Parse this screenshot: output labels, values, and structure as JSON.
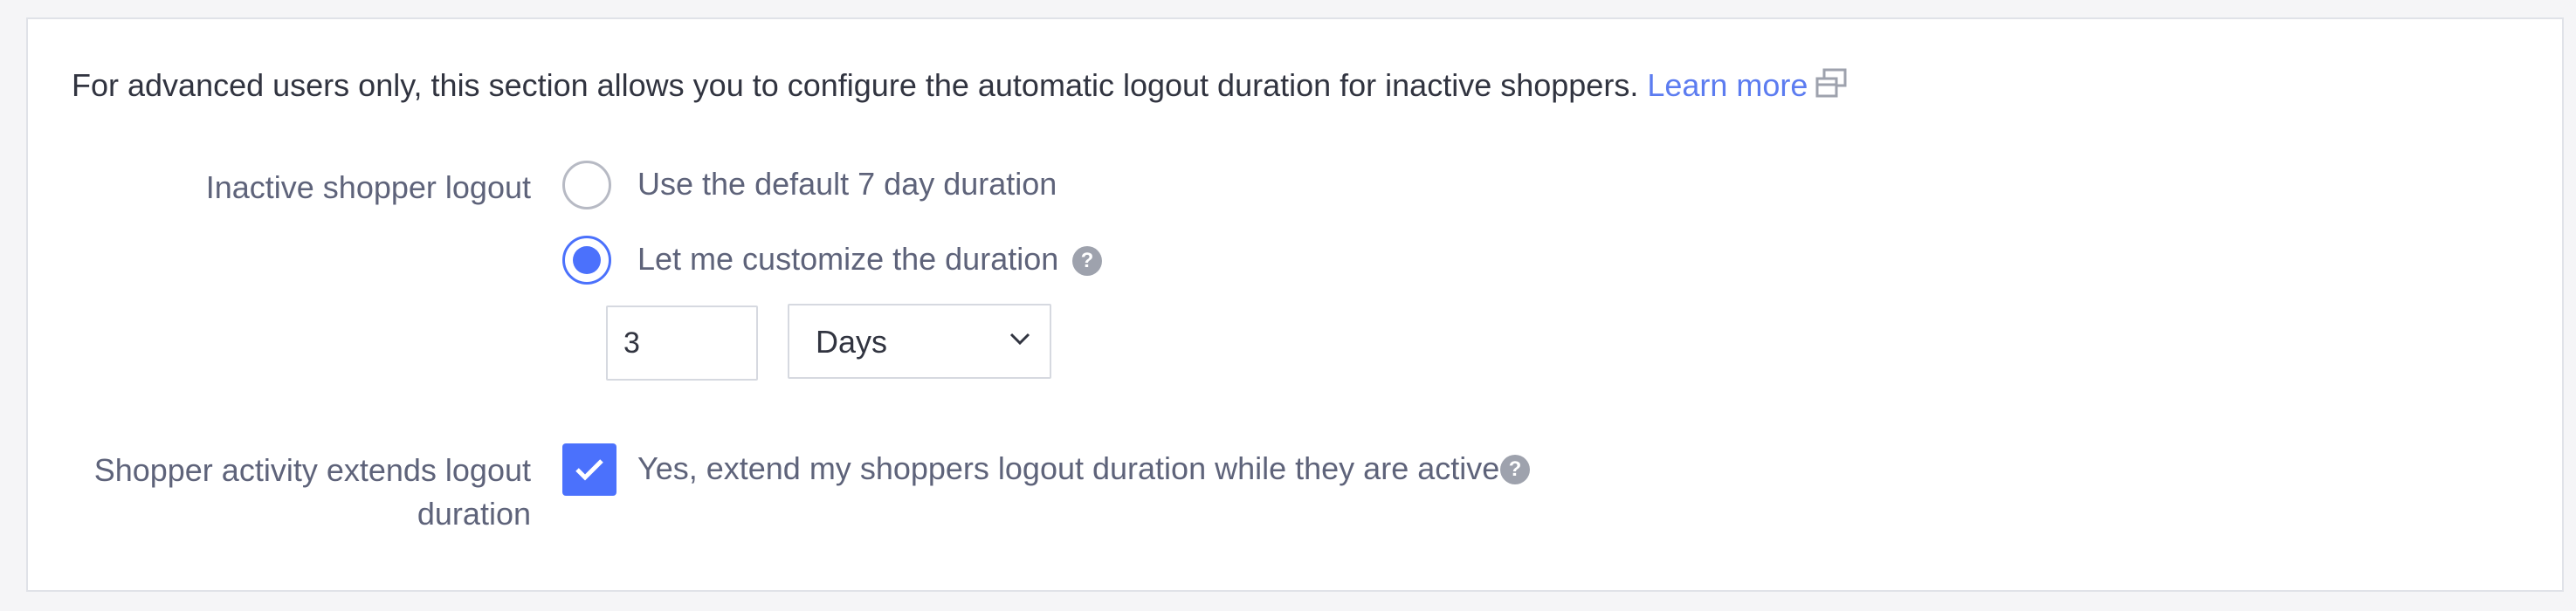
{
  "intro": {
    "text": "For advanced users only, this section allows you to configure the automatic logout duration for inactive shoppers.",
    "learn_more": "Learn more",
    "external_icon": "external-link-icon"
  },
  "inactive_logout": {
    "label": "Inactive shopper logout",
    "options": [
      {
        "label": "Use the default 7 day duration",
        "selected": false
      },
      {
        "label": "Let me customize the duration",
        "selected": true,
        "help_icon": "help-icon"
      }
    ],
    "duration_value": "3",
    "duration_unit": "Days",
    "unit_icon": "chevron-down-icon"
  },
  "activity_extends": {
    "label_line1": "Shopper activity extends logout",
    "label_line2": "duration",
    "checkbox_label": "Yes, extend my shoppers logout duration while they are active",
    "checked": true,
    "help_icon": "help-icon"
  },
  "colors": {
    "accent": "#4b71fc",
    "link": "#5c7cf0",
    "label": "#5e637a",
    "text": "#313440",
    "help": "#9ea2ad"
  }
}
